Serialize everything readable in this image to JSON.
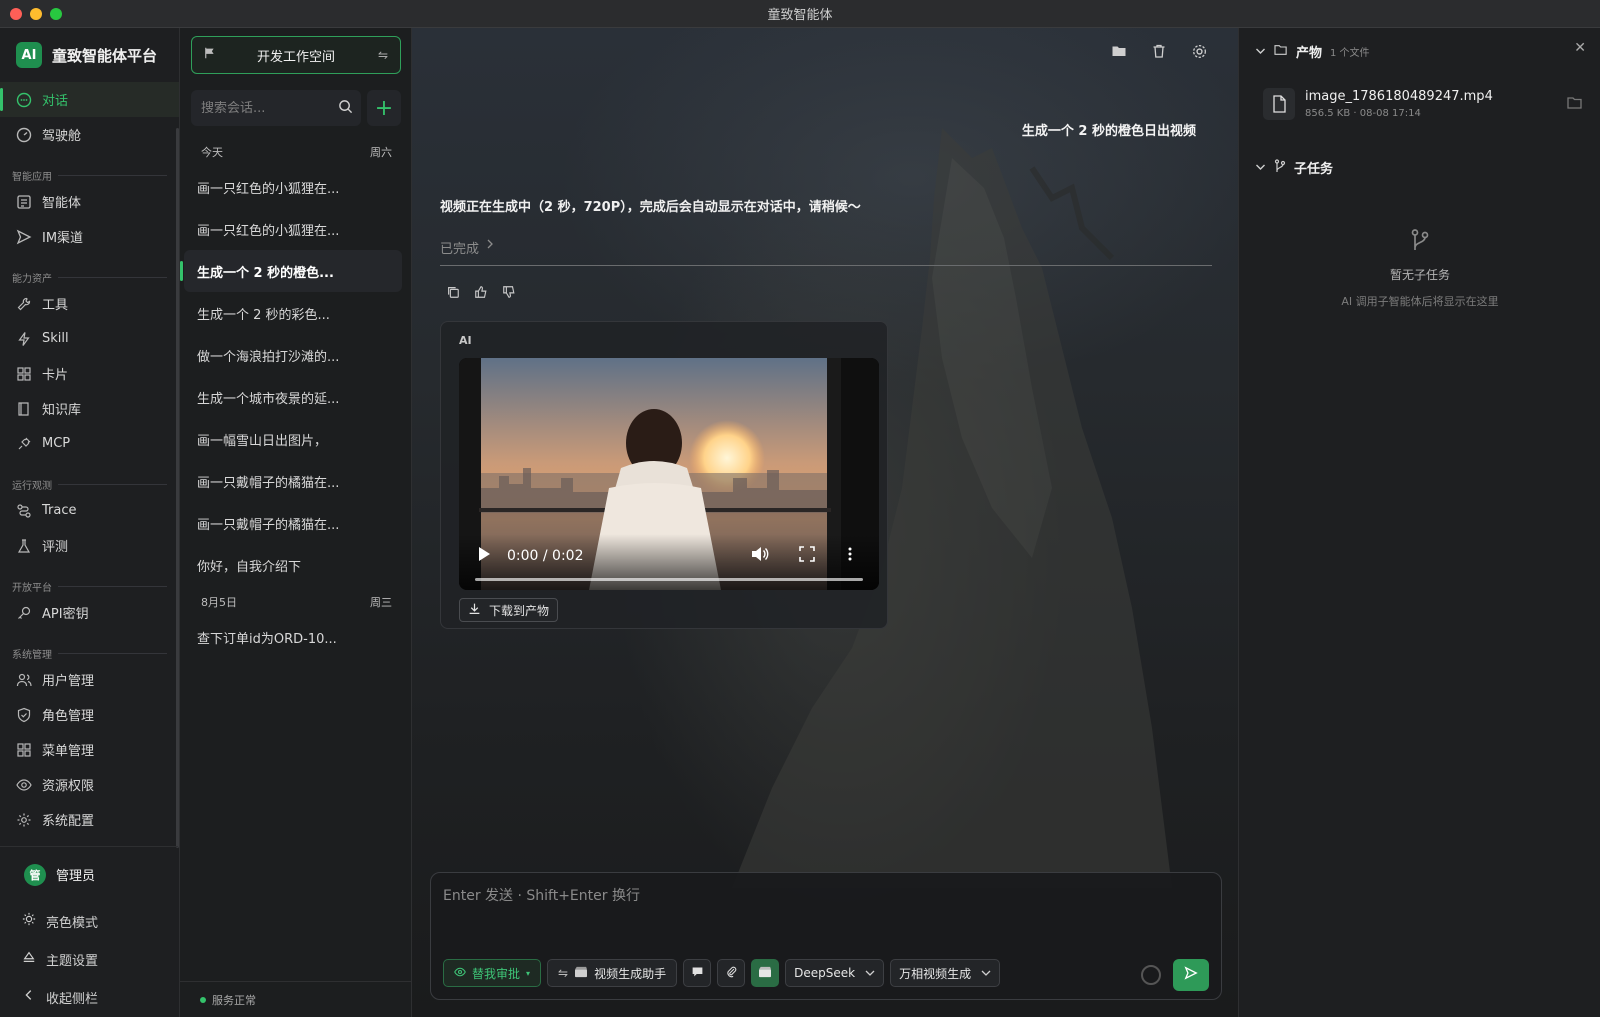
{
  "window": {
    "title": "童致智能体"
  },
  "brand": {
    "logo": "AI",
    "name": "童致智能体平台"
  },
  "nav": {
    "top_items": [
      {
        "label": "对话",
        "icon": "chat-icon",
        "active": true
      },
      {
        "label": "驾驶舱",
        "icon": "dashboard-icon",
        "active": false
      }
    ],
    "groups": [
      {
        "title": "智能应用",
        "items": [
          {
            "label": "智能体",
            "icon": "agent-icon"
          },
          {
            "label": "IM渠道",
            "icon": "send-icon"
          }
        ]
      },
      {
        "title": "能力资产",
        "items": [
          {
            "label": "工具",
            "icon": "wrench-icon"
          },
          {
            "label": "Skill",
            "icon": "bolt-icon"
          },
          {
            "label": "卡片",
            "icon": "grid-icon"
          },
          {
            "label": "知识库",
            "icon": "book-icon"
          },
          {
            "label": "MCP",
            "icon": "plug-icon"
          }
        ]
      },
      {
        "title": "运行观测",
        "items": [
          {
            "label": "Trace",
            "icon": "trace-icon"
          },
          {
            "label": "评测",
            "icon": "flask-icon"
          }
        ]
      },
      {
        "title": "开放平台",
        "items": [
          {
            "label": "API密钥",
            "icon": "key-icon"
          }
        ]
      },
      {
        "title": "系统管理",
        "items": [
          {
            "label": "用户管理",
            "icon": "users-icon"
          },
          {
            "label": "角色管理",
            "icon": "shield-icon"
          },
          {
            "label": "菜单管理",
            "icon": "menu-grid-icon"
          },
          {
            "label": "资源权限",
            "icon": "eye-icon"
          },
          {
            "label": "系统配置",
            "icon": "gear-icon"
          }
        ]
      }
    ],
    "user": {
      "avatar": "管",
      "name": "管理员"
    },
    "footer": [
      {
        "label": "亮色模式",
        "icon": "sun-icon"
      },
      {
        "label": "主题设置",
        "icon": "theme-icon"
      },
      {
        "label": "收起侧栏",
        "icon": "chevron-left-icon"
      }
    ]
  },
  "sessions": {
    "workspace": "开发工作空间",
    "search_placeholder": "搜索会话...",
    "groups": [
      {
        "date": "今天",
        "weekday": "周六",
        "items": [
          {
            "title": "画一只红色的小狐狸在...",
            "active": false
          },
          {
            "title": "画一只红色的小狐狸在...",
            "active": false
          },
          {
            "title": "生成一个 2 秒的橙色...",
            "active": true
          },
          {
            "title": "生成一个 2 秒的彩色...",
            "active": false
          },
          {
            "title": "做一个海浪拍打沙滩的...",
            "active": false
          },
          {
            "title": "生成一个城市夜景的延...",
            "active": false
          },
          {
            "title": "画一幅雪山日出图片，",
            "active": false
          },
          {
            "title": "画一只戴帽子的橘猫在...",
            "active": false
          },
          {
            "title": "画一只戴帽子的橘猫在...",
            "active": false
          },
          {
            "title": "你好，自我介绍下",
            "active": false
          }
        ]
      },
      {
        "date": "8月5日",
        "weekday": "周三",
        "items": [
          {
            "title": "查下订单id为ORD-10...",
            "active": false
          }
        ]
      }
    ],
    "status": "服务正常"
  },
  "chat": {
    "user_message": "生成一个 2 秒的橙色日出视频",
    "ai_message": "视频正在生成中（2 秒，720P），完成后会自动显示在对话中，请稍候～",
    "done_label": "已完成",
    "card": {
      "label": "AI",
      "time": "0:00 / 0:02",
      "progress": 0,
      "download_label": "下载到产物"
    },
    "composer": {
      "placeholder": "Enter 发送 · Shift+Enter 换行",
      "approval_label": "替我审批",
      "assistant_label": "视频生成助手",
      "model": "DeepSeek",
      "mode": "万相视频生成"
    }
  },
  "side": {
    "artifacts_title": "产物",
    "artifacts_count": "1 个文件",
    "file": {
      "name": "image_1786180489247.mp4",
      "size": "856.5 KB",
      "date": "08-08 17:14"
    },
    "subtasks_title": "子任务",
    "empty_title": "暂无子任务",
    "empty_desc": "AI 调用子智能体后将显示在这里"
  }
}
